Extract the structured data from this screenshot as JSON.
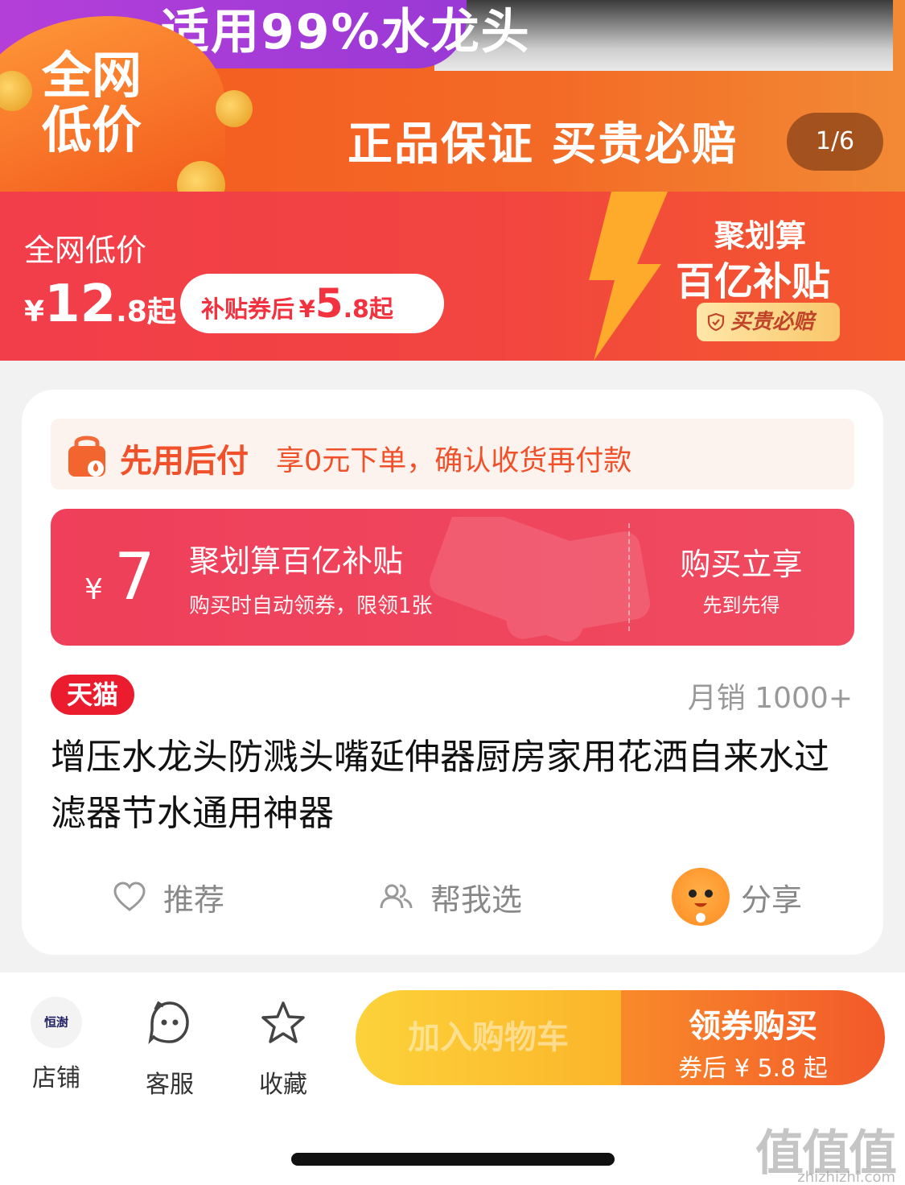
{
  "banner": {
    "top_text": "适用99%水龙头",
    "badge": "全网低价",
    "slogan": "正品保证  买贵必赔",
    "counter": "1/6"
  },
  "price_band": {
    "label": "全网低价",
    "currency": "¥",
    "price_int": "12",
    "price_dec": ".8起",
    "pill_label": "补贴券后",
    "pill_currency": "¥",
    "pill_int": "5",
    "pill_dec": ".8起",
    "brand_line1": "聚划算",
    "brand_line2": "百亿补贴",
    "brand_badge": "买贵必赔"
  },
  "bnpl": {
    "title": "先用后付",
    "desc": "享0元下单，确认收货再付款"
  },
  "coupon": {
    "currency": "¥",
    "amount": "7",
    "title": "聚划算百亿补贴",
    "desc": "购买时自动领券，限领1张",
    "button_title": "购买立享",
    "button_desc": "先到先得"
  },
  "product": {
    "store_tag": "天猫",
    "sales": "月销 1000+",
    "title": "增压水龙头防溅头嘴延伸器厨房家用花洒自来水过滤器节水通用神器"
  },
  "actions": {
    "recommend": "推荐",
    "help_choose": "帮我选",
    "share": "分享"
  },
  "bottom_bar": {
    "shop_logo_text": "恒澍",
    "shop": "店铺",
    "service": "客服",
    "favorite": "收藏",
    "add_cart": "加入购物车",
    "buy": "领券购买",
    "buy_sub": "券后 ¥ 5.8 起"
  },
  "watermark": {
    "text": "值值值",
    "url": "zhizhizhi.com"
  },
  "colors": {
    "brand_red": "#ec1c2f",
    "coupon_pink": "#ef4a60",
    "buy_orange": "#f2592a",
    "cart_yellow": "#fbb52a"
  }
}
